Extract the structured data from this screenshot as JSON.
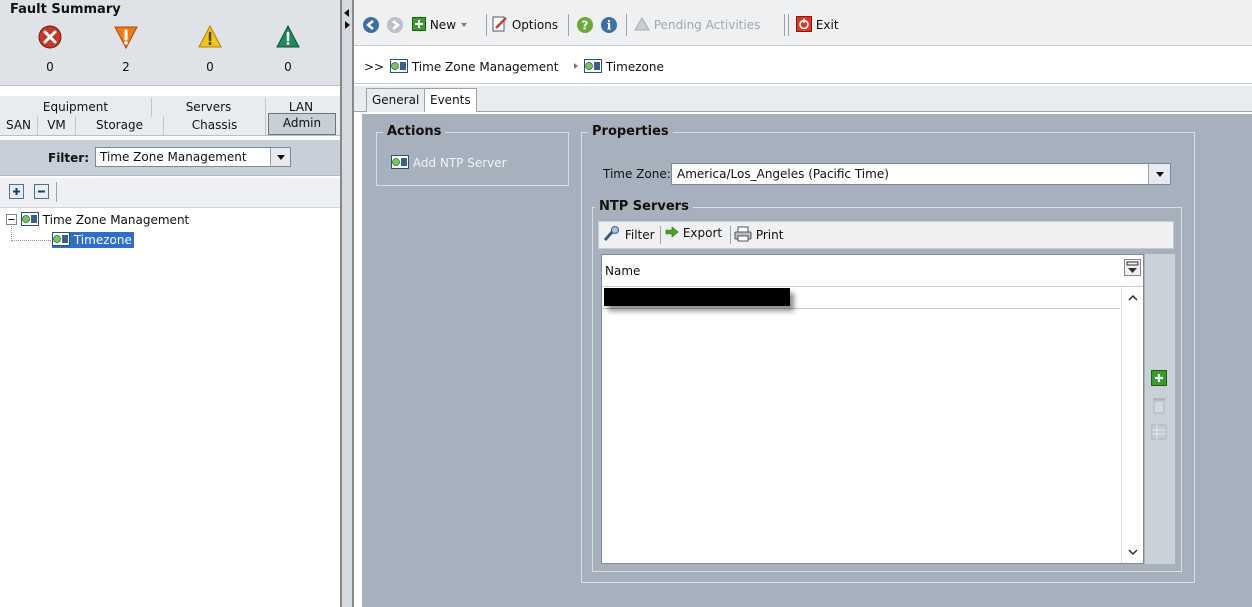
{
  "fault_summary": {
    "title": "Fault Summary",
    "items": [
      {
        "icon": "critical-icon",
        "count": "0",
        "color": "#c0392b"
      },
      {
        "icon": "major-icon",
        "count": "2",
        "color": "#f07a1a"
      },
      {
        "icon": "minor-icon",
        "count": "0",
        "color": "#f2c417"
      },
      {
        "icon": "warning-icon",
        "count": "0",
        "color": "#1e8a5c"
      }
    ]
  },
  "nav_tabs": {
    "row1": [
      "Equipment",
      "Servers",
      "LAN"
    ],
    "row2": [
      "SAN",
      "VM",
      "Storage",
      "Chassis",
      "Admin"
    ],
    "selected": "Admin"
  },
  "filter": {
    "label": "Filter:",
    "value": "Time Zone Management"
  },
  "tree": {
    "root": "Time Zone Management",
    "child": "Timezone"
  },
  "toolbar": {
    "new_label": "New",
    "options_label": "Options",
    "pending_label": "Pending Activities",
    "exit_label": "Exit"
  },
  "breadcrumb": {
    "prefix": ">>",
    "items": [
      "Time Zone Management",
      "Timezone"
    ]
  },
  "tabs": [
    {
      "label": "General",
      "selected": true
    },
    {
      "label": "Events",
      "selected": false
    }
  ],
  "actions": {
    "legend": "Actions",
    "items": [
      "Add NTP Server"
    ]
  },
  "properties": {
    "legend": "Properties",
    "timezone_label": "Time Zone:",
    "timezone_value": "America/Los_Angeles (Pacific Time)"
  },
  "ntp": {
    "legend": "NTP Servers",
    "filter_label": "Filter",
    "export_label": "Export",
    "print_label": "Print",
    "column_name": "Name"
  },
  "colors": {
    "content_bg": "#a7b1bd",
    "selection": "#2f6fc7"
  }
}
